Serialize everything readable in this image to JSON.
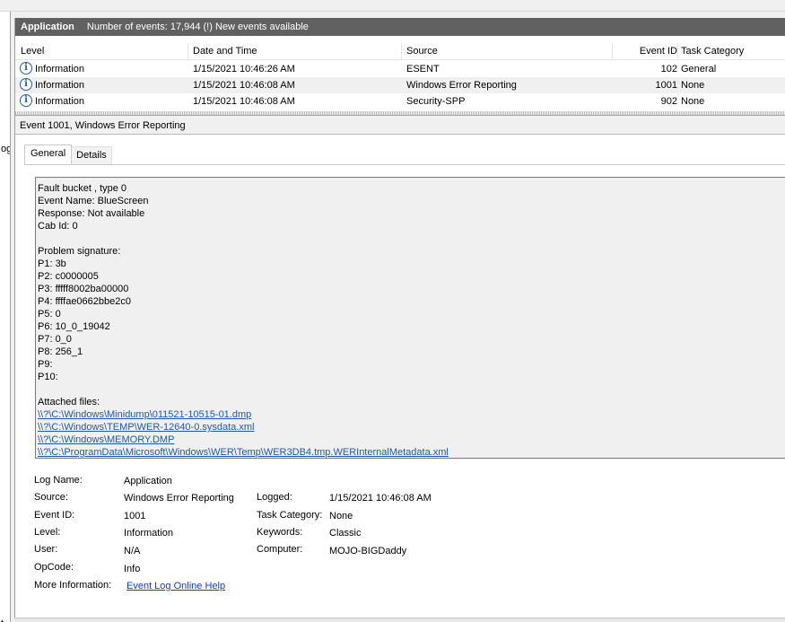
{
  "window": {
    "left_fragment": "og",
    "left_fragment2": "t"
  },
  "header": {
    "log_name": "Application",
    "summary": "Number of events: 17,944 (!) New events available"
  },
  "grid": {
    "columns": [
      "Level",
      "Date and Time",
      "Source",
      "Event ID",
      "Task Category"
    ],
    "rows": [
      {
        "level": "Information",
        "icon": "info-icon",
        "datetime": "1/15/2021 10:46:26 AM",
        "source": "ESENT",
        "event_id": "102",
        "task_category": "General"
      },
      {
        "level": "Information",
        "icon": "info-icon",
        "datetime": "1/15/2021 10:46:08 AM",
        "source": "Windows Error Reporting",
        "event_id": "1001",
        "task_category": "None"
      },
      {
        "level": "Information",
        "icon": "info-icon",
        "datetime": "1/15/2021 10:46:08 AM",
        "source": "Security-SPP",
        "event_id": "902",
        "task_category": "None"
      }
    ]
  },
  "detail": {
    "title": "Event 1001, Windows Error Reporting",
    "tabs": [
      "General",
      "Details"
    ],
    "active_tab": "General",
    "description_lines": [
      "Fault bucket , type 0",
      "Event Name: BlueScreen",
      "Response: Not available",
      "Cab Id: 0",
      "",
      "Problem signature:",
      "P1: 3b",
      "P2: c0000005",
      "P3: fffff8002ba00000",
      "P4: ffffae0662bbe2c0",
      "P5: 0",
      "P6: 10_0_19042",
      "P7: 0_0",
      "P8: 256_1",
      "P9:",
      "P10:",
      "",
      "Attached files:"
    ],
    "attached_files": [
      "\\\\?\\C:\\Windows\\Minidump\\011521-10515-01.dmp",
      "\\\\?\\C:\\Windows\\TEMP\\WER-12640-0.sysdata.xml",
      "\\\\?\\C:\\Windows\\MEMORY.DMP",
      "\\\\?\\C:\\ProgramData\\Microsoft\\Windows\\WER\\Temp\\WER3DB4.tmp.WERInternalMetadata.xml"
    ],
    "properties": {
      "log_name_label": "Log Name:",
      "log_name": "Application",
      "source_label": "Source:",
      "source": "Windows Error Reporting",
      "logged_label": "Logged:",
      "logged": "1/15/2021 10:46:08 AM",
      "event_id_label": "Event ID:",
      "event_id": "1001",
      "task_category_label": "Task Category:",
      "task_category": "None",
      "level_label": "Level:",
      "level": "Information",
      "keywords_label": "Keywords:",
      "keywords": "Classic",
      "user_label": "User:",
      "user": "N/A",
      "computer_label": "Computer:",
      "computer": "MOJO-BIGDaddy",
      "opcode_label": "OpCode:",
      "opcode": "Info",
      "more_info_label": "More Information:",
      "more_info_link": "Event Log Online Help"
    }
  }
}
